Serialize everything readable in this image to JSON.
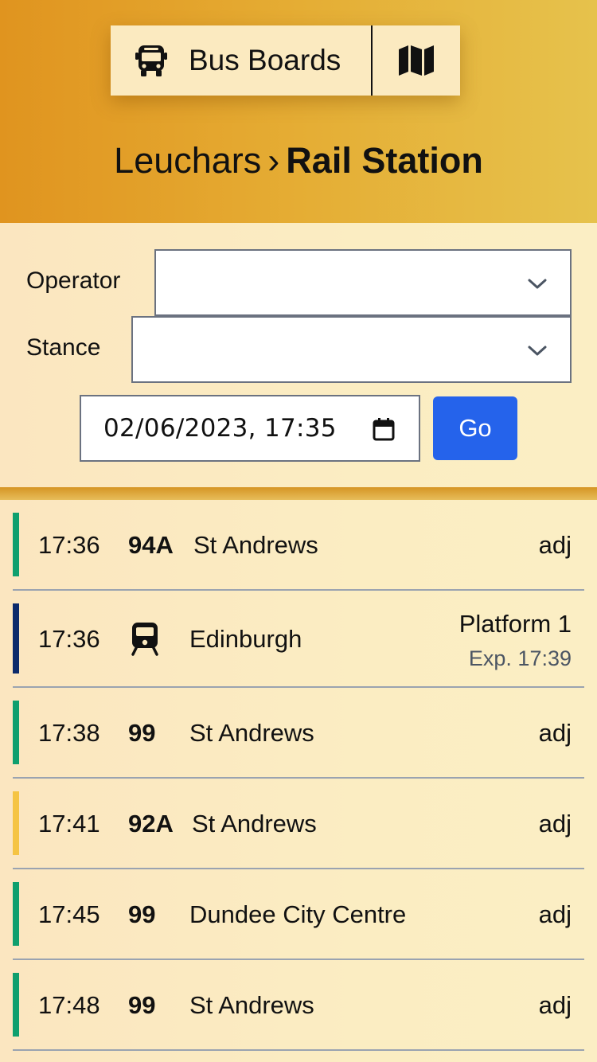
{
  "header": {
    "brand_label": "Bus Boards",
    "locality": "Leuchars",
    "separator": "›",
    "stop_name": "Rail Station"
  },
  "filters": {
    "operator_label": "Operator",
    "operator_value": "",
    "stance_label": "Stance",
    "stance_value": "",
    "datetime_value": "02/06/2023, 17:35",
    "go_label": "Go"
  },
  "departures": [
    {
      "time": "17:36",
      "service": "94A",
      "mode": "bus",
      "destination": "St Andrews",
      "status": "adj",
      "color": "#0f9f6e"
    },
    {
      "time": "17:36",
      "service": "",
      "mode": "train",
      "destination": "Edinburgh",
      "status": "Platform 1",
      "expected": "Exp. 17:39",
      "color": "#0b2a6b"
    },
    {
      "time": "17:38",
      "service": "99",
      "mode": "bus",
      "destination": "St Andrews",
      "status": "adj",
      "color": "#0f9f6e"
    },
    {
      "time": "17:41",
      "service": "92A",
      "mode": "bus",
      "destination": "St Andrews",
      "status": "adj",
      "color": "#f5c443"
    },
    {
      "time": "17:45",
      "service": "99",
      "mode": "bus",
      "destination": "Dundee City Centre",
      "status": "adj",
      "color": "#0f9f6e"
    },
    {
      "time": "17:48",
      "service": "99",
      "mode": "bus",
      "destination": "St Andrews",
      "status": "adj",
      "color": "#0f9f6e"
    }
  ],
  "icons": {
    "brand": "bus-icon",
    "map": "map-icon",
    "select": "chevron-down-icon",
    "datetime": "calendar-icon",
    "train": "train-icon"
  }
}
